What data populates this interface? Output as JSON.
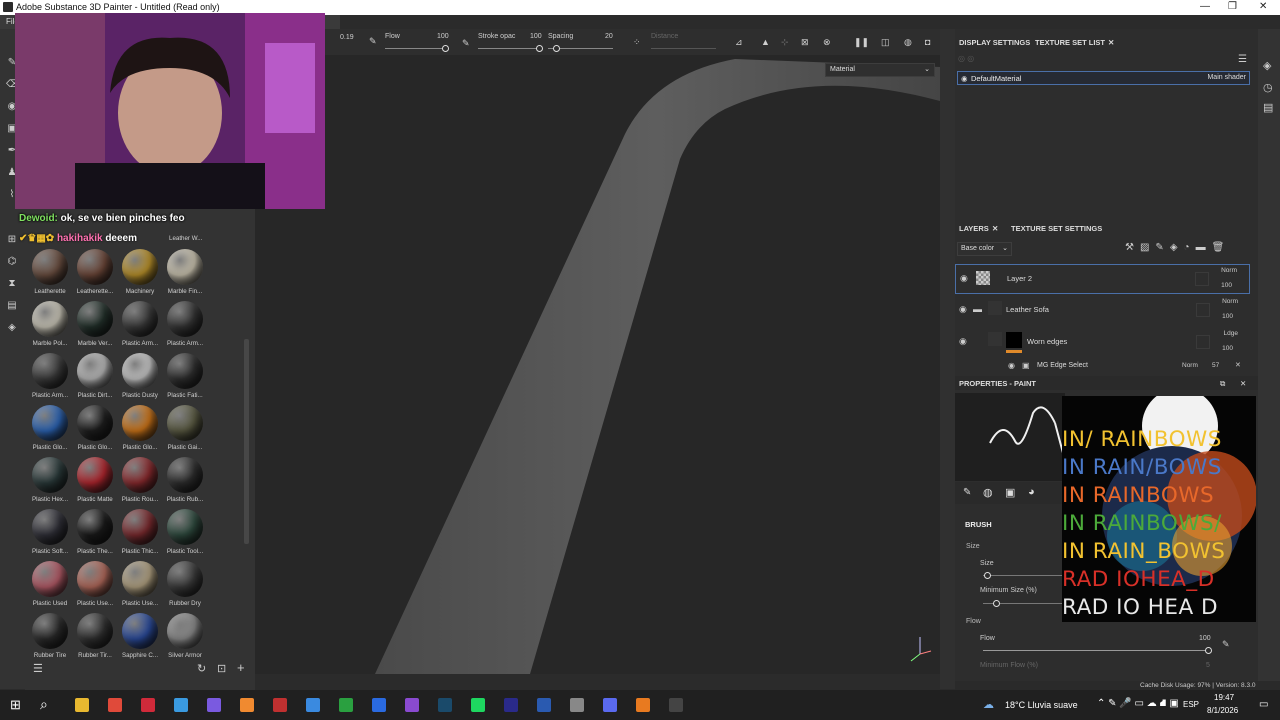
{
  "window": {
    "title": "Adobe Substance 3D Painter - Untitled (Read only)",
    "menu_first": "File"
  },
  "stream": {
    "chat1": {
      "user": "Dewoid:",
      "msg": "ok, se ve bien pinches feo"
    },
    "chat2": {
      "user": "hakihakik",
      "msg": "deeem"
    }
  },
  "shelf": {
    "top_labels": [
      "Leather W..."
    ],
    "materials": [
      {
        "label": "Leatherette",
        "color": "#6a4e40"
      },
      {
        "label": "Leatherette...",
        "color": "#6b4638"
      },
      {
        "label": "Machinery",
        "color": "#b8902a"
      },
      {
        "label": "Marble Fin...",
        "color": "#c9c2ae"
      },
      {
        "label": "Marble Pol...",
        "color": "#c8c4b6"
      },
      {
        "label": "Marble Ver...",
        "color": "#22302a"
      },
      {
        "label": "Plastic Arm...",
        "color": "#3a3a3a"
      },
      {
        "label": "Plastic Arm...",
        "color": "#343434"
      },
      {
        "label": "Plastic Arm...",
        "color": "#3b3b3b"
      },
      {
        "label": "Plastic Dirt...",
        "color": "#b8b8b8"
      },
      {
        "label": "Plastic Dusty",
        "color": "#c6c6c6"
      },
      {
        "label": "Plastic Fati...",
        "color": "#2f2f2f"
      },
      {
        "label": "Plastic Glo...",
        "color": "#2c64b4"
      },
      {
        "label": "Plastic Glo...",
        "color": "#1e1e1e"
      },
      {
        "label": "Plastic Glo...",
        "color": "#cc7418"
      },
      {
        "label": "Plastic Gai...",
        "color": "#5a5a42"
      },
      {
        "label": "Plastic Hex...",
        "color": "#2a3a3a"
      },
      {
        "label": "Plastic Matte",
        "color": "#b0262e"
      },
      {
        "label": "Plastic Rou...",
        "color": "#8a2a2e"
      },
      {
        "label": "Plastic Rub...",
        "color": "#2e2e2e"
      },
      {
        "label": "Plastic Soft...",
        "color": "#303038"
      },
      {
        "label": "Plastic The...",
        "color": "#1a1a1a"
      },
      {
        "label": "Plastic Thic...",
        "color": "#7a2a2e"
      },
      {
        "label": "Plastic Tool...",
        "color": "#2e4a3e"
      },
      {
        "label": "Plastic Used",
        "color": "#b25a66"
      },
      {
        "label": "Plastic Use...",
        "color": "#b0685a"
      },
      {
        "label": "Plastic Use...",
        "color": "#b0a080"
      },
      {
        "label": "Rubber Dry",
        "color": "#3a3a3a"
      },
      {
        "label": "Rubber Tire",
        "color": "#2a2a2a"
      },
      {
        "label": "Rubber Tir...",
        "color": "#303030"
      },
      {
        "label": "Sapphire C...",
        "color": "#2a4a9a"
      },
      {
        "label": "Silver Armor",
        "color": "#8a8a8a"
      }
    ]
  },
  "toolbar": {
    "size_val": "0.19",
    "flow_label": "Flow",
    "flow_val": "100",
    "stroke_label": "Stroke opac",
    "stroke_val": "100",
    "spacing_label": "Spacing",
    "spacing_val": "20",
    "distance_label": "Distance",
    "material_dropdown": "Material"
  },
  "texture_set": {
    "tab_display": "DISPLAY SETTINGS",
    "tab_list": "TEXTURE SET LIST",
    "item_name": "DefaultMaterial",
    "item_shader": "Main shader"
  },
  "layers": {
    "tab_layers": "LAYERS",
    "tab_tss": "TEXTURE SET SETTINGS",
    "channel": "Base color",
    "items": [
      {
        "name": "Layer 2",
        "blend": "Norm",
        "opacity": "100"
      },
      {
        "name": "Leather Sofa",
        "blend": "Norm",
        "opacity": "100"
      },
      {
        "name": "Worn edges",
        "blend": "Ldge",
        "opacity": "100"
      }
    ],
    "effect": {
      "name": "MG Edge Select",
      "blend": "Norm",
      "opacity": "57"
    }
  },
  "properties": {
    "title": "PROPERTIES - PAINT",
    "brush_header": "BRUSH",
    "size_section": "Size",
    "size_label": "Size",
    "min_size_label": "Minimum Size (%)",
    "flow_section": "Flow",
    "flow_label": "Flow",
    "flow_val": "100",
    "min_flow_label": "Minimum Flow (%)",
    "min_flow_val": "5"
  },
  "album": {
    "lines": [
      {
        "text": "IN/ RAINBOWS",
        "color": "#f2c230"
      },
      {
        "text": "IN RAIN/BOWS",
        "color": "#4a78c8"
      },
      {
        "text": "IN RAINBOWS",
        "color": "#e8682a"
      },
      {
        "text": "IN RAINBOWS/",
        "color": "#4caa3a"
      },
      {
        "text": "IN RAIN_BOWS",
        "color": "#f2c230"
      },
      {
        "text": "RAD IOHEA_D",
        "color": "#d83028"
      },
      {
        "text": "RAD IO HEA D",
        "color": "#e8e8e8"
      }
    ]
  },
  "statusbar": {
    "text": "Cache Disk Usage:   97% | Version: 8.3.0"
  },
  "taskbar": {
    "weather": "18°C  Lluvia suave",
    "lang": "ESP",
    "time": "19:47",
    "date": "8/1/2026"
  }
}
